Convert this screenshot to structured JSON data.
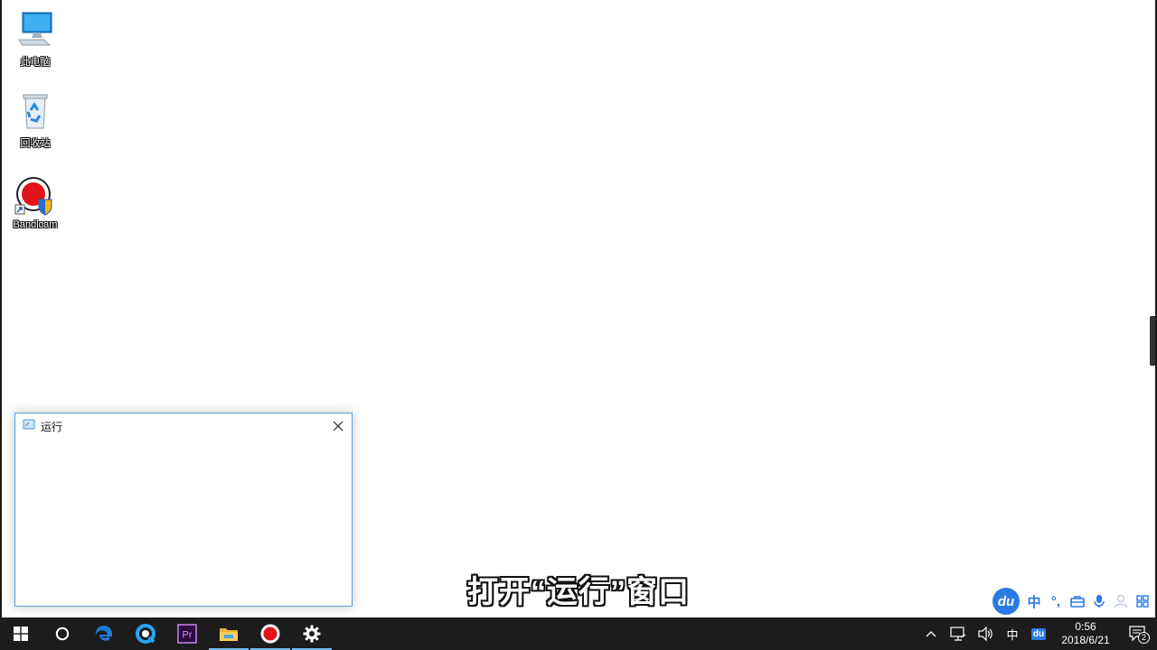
{
  "desktop": {
    "icons": [
      {
        "label": "此电脑",
        "icon": "computer-icon"
      },
      {
        "label": "回收站",
        "icon": "recycle-bin-icon"
      },
      {
        "label": "Bandicam",
        "icon": "bandicam-icon"
      }
    ]
  },
  "run_window": {
    "title": "运行",
    "title_icon": "run-icon",
    "close_icon": "close-icon"
  },
  "caption": {
    "text": "打开“运行”窗口"
  },
  "ime_toolbar": {
    "logo": "du",
    "items": [
      {
        "label": "中",
        "icon": "chinese-mode-icon"
      },
      {
        "label": "°,",
        "icon": "punctuation-icon"
      },
      {
        "icon": "toolbox-icon"
      },
      {
        "icon": "microphone-icon"
      },
      {
        "icon": "user-icon"
      },
      {
        "icon": "grid-menu-icon"
      }
    ]
  },
  "taskbar": {
    "apps": [
      {
        "name": "start",
        "icon": "windows-logo-icon",
        "active": false
      },
      {
        "name": "cortana",
        "icon": "cortana-circle-icon",
        "active": false
      },
      {
        "name": "edge",
        "icon": "edge-icon",
        "active": false
      },
      {
        "name": "qq-browser",
        "icon": "browser-icon",
        "active": false
      },
      {
        "name": "premiere",
        "label": "Pr",
        "icon": "premiere-icon",
        "active": false
      },
      {
        "name": "file-explorer",
        "icon": "folder-icon",
        "active": true
      },
      {
        "name": "bandicam",
        "icon": "record-icon",
        "active": true
      },
      {
        "name": "settings",
        "icon": "gear-icon",
        "active": true
      }
    ],
    "tray": {
      "ime_label": "中",
      "ime_logo": "du",
      "time": "0:56",
      "date": "2018/6/21",
      "notifications": "2"
    }
  },
  "colors": {
    "taskbar_bg": "#1c1c1c",
    "accent": "#76b9ed",
    "ime_blue": "#2b7be5",
    "window_border": "#5a9bd8"
  }
}
